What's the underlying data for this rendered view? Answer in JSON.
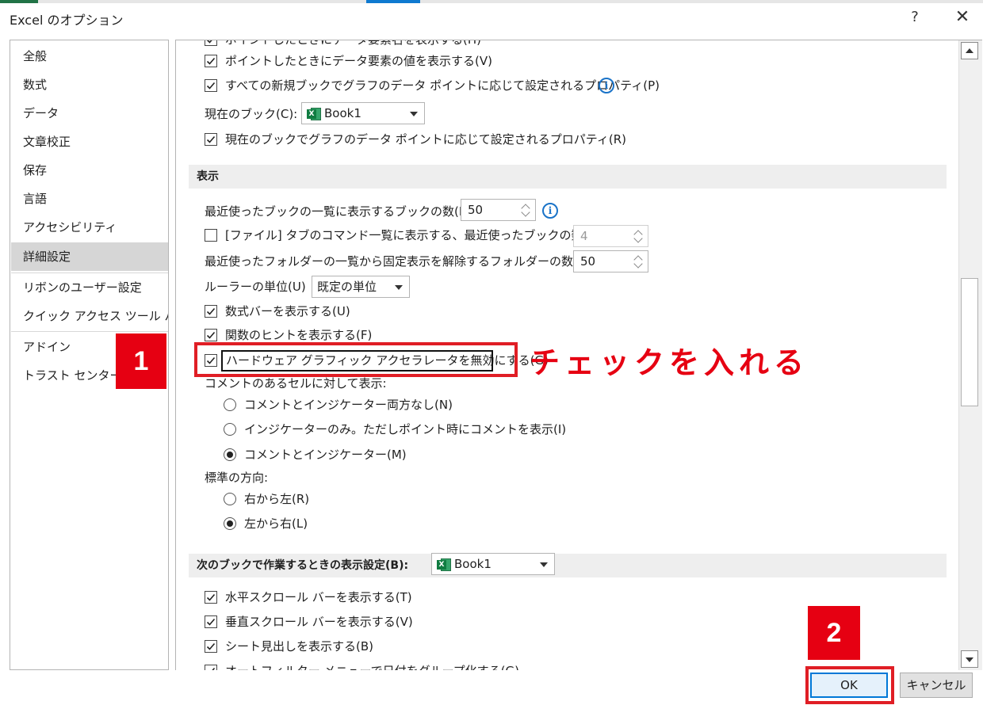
{
  "window": {
    "title": "Excel のオプション",
    "help_label": "?",
    "close_label": "✕"
  },
  "sidebar": {
    "items": [
      {
        "label": "全般"
      },
      {
        "label": "数式"
      },
      {
        "label": "データ"
      },
      {
        "label": "文章校正"
      },
      {
        "label": "保存"
      },
      {
        "label": "言語"
      },
      {
        "label": "アクセシビリティ"
      },
      {
        "label": "詳細設定"
      },
      {
        "label": "リボンのユーザー設定"
      },
      {
        "label": "クイック アクセス ツール バー"
      },
      {
        "label": "アドイン"
      },
      {
        "label": "トラスト センター"
      }
    ],
    "active_index": 7
  },
  "chart_section": {
    "cb_partial": {
      "label": "ポイントしたときにデータ要素名を表示する(H)",
      "checked": true
    },
    "cb_value": {
      "label": "ポイントしたときにデータ要素の値を表示する(V)",
      "checked": true
    },
    "cb_all_books": {
      "label": "すべての新規ブックでグラフのデータ ポイントに応じて設定されるプロパティ(P)",
      "checked": true
    },
    "current_book_label": "現在のブック(C):",
    "current_book_value": "Book1",
    "cb_current_book": {
      "label": "現在のブックでグラフのデータ ポイントに応じて設定されるプロパティ(R)",
      "checked": true
    }
  },
  "display_section": {
    "header": "表示",
    "recent_books_label": "最近使ったブックの一覧に表示するブックの数(R):",
    "recent_books_value": "50",
    "cb_file_tab": {
      "label": "[ファイル] タブのコマンド一覧に表示する、最近使ったブックの数(Q):",
      "checked": false
    },
    "file_tab_value": "4",
    "recent_folders_label": "最近使ったフォルダーの一覧から固定表示を解除するフォルダーの数(F):",
    "recent_folders_value": "50",
    "ruler_label": "ルーラーの単位(U)",
    "ruler_value": "既定の単位",
    "cb_formula_bar": {
      "label": "数式バーを表示する(U)",
      "checked": true
    },
    "cb_function_tips": {
      "label": "関数のヒントを表示する(F)",
      "checked": true
    },
    "cb_hw_accel": {
      "label": "ハードウェア グラフィック アクセラレータを無効にする(G)",
      "checked": true
    },
    "comments_label": "コメントのあるセルに対して表示:",
    "comment_options": [
      {
        "label": "コメントとインジケーター両方なし(N)",
        "selected": false
      },
      {
        "label": "インジケーターのみ。ただしポイント時にコメントを表示(I)",
        "selected": false
      },
      {
        "label": "コメントとインジケーター(M)",
        "selected": true
      }
    ],
    "direction_label": "標準の方向:",
    "direction_options": [
      {
        "label": "右から左(R)",
        "selected": false
      },
      {
        "label": "左から右(L)",
        "selected": true
      }
    ]
  },
  "workbook_section": {
    "header": "次のブックで作業するときの表示設定(B):",
    "book_value": "Book1",
    "cb_hscroll": {
      "label": "水平スクロール バーを表示する(T)",
      "checked": true
    },
    "cb_vscroll": {
      "label": "垂直スクロール バーを表示する(V)",
      "checked": true
    },
    "cb_sheet_tabs": {
      "label": "シート見出しを表示する(B)",
      "checked": true
    },
    "cb_autofilter": {
      "label": "オートフィルター メニューで日付をグループ化する(G)",
      "checked": true
    }
  },
  "annotations": {
    "step1": "1",
    "step2": "2",
    "callout": "チェックを入れる"
  },
  "footer": {
    "ok_label": "OK",
    "cancel_label": "キャンセル"
  },
  "colors": {
    "annotation_red": "#e60012",
    "excel_green": "#217346",
    "info_blue": "#1a73c8",
    "ok_border": "#0078d7"
  },
  "icons": {
    "check": "check-icon",
    "info": "info-icon",
    "excel": "excel-icon",
    "dropdown": "chevron-down-icon"
  }
}
